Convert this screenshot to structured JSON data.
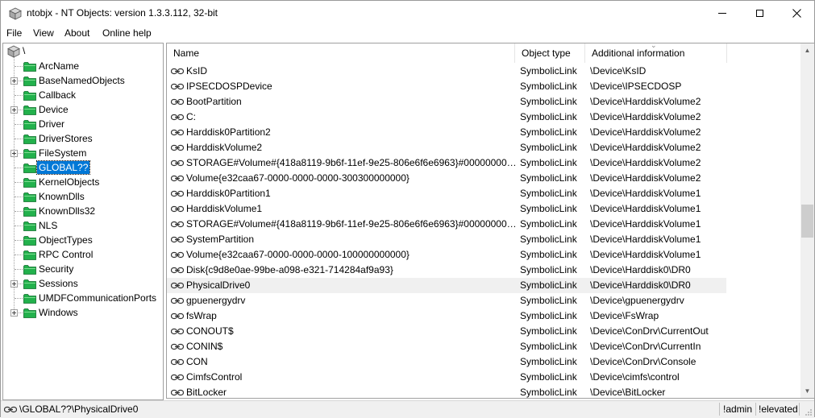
{
  "window": {
    "title": "ntobjx - NT Objects: version 1.3.3.112, 32-bit"
  },
  "menu": [
    "File",
    "View",
    "About",
    "Online help"
  ],
  "tree": {
    "root_label": "\\",
    "items": [
      {
        "label": "ArcName",
        "expandable": false,
        "selected": false
      },
      {
        "label": "BaseNamedObjects",
        "expandable": true,
        "selected": false
      },
      {
        "label": "Callback",
        "expandable": false,
        "selected": false
      },
      {
        "label": "Device",
        "expandable": true,
        "selected": false
      },
      {
        "label": "Driver",
        "expandable": false,
        "selected": false
      },
      {
        "label": "DriverStores",
        "expandable": false,
        "selected": false
      },
      {
        "label": "FileSystem",
        "expandable": true,
        "selected": false
      },
      {
        "label": "GLOBAL??",
        "expandable": false,
        "selected": true
      },
      {
        "label": "KernelObjects",
        "expandable": false,
        "selected": false
      },
      {
        "label": "KnownDlls",
        "expandable": false,
        "selected": false
      },
      {
        "label": "KnownDlls32",
        "expandable": false,
        "selected": false
      },
      {
        "label": "NLS",
        "expandable": false,
        "selected": false
      },
      {
        "label": "ObjectTypes",
        "expandable": false,
        "selected": false
      },
      {
        "label": "RPC Control",
        "expandable": false,
        "selected": false
      },
      {
        "label": "Security",
        "expandable": false,
        "selected": false
      },
      {
        "label": "Sessions",
        "expandable": true,
        "selected": false
      },
      {
        "label": "UMDFCommunicationPorts",
        "expandable": false,
        "selected": false
      },
      {
        "label": "Windows",
        "expandable": true,
        "selected": false
      }
    ]
  },
  "list": {
    "columns": [
      "Name",
      "Object type",
      "Additional information"
    ],
    "hovered_row": 14,
    "rows": [
      {
        "name": "KsID",
        "type": "SymbolicLink",
        "info": "\\Device\\KsID"
      },
      {
        "name": "IPSECDOSPDevice",
        "type": "SymbolicLink",
        "info": "\\Device\\IPSECDOSP"
      },
      {
        "name": "BootPartition",
        "type": "SymbolicLink",
        "info": "\\Device\\HarddiskVolume2"
      },
      {
        "name": "C:",
        "type": "SymbolicLink",
        "info": "\\Device\\HarddiskVolume2"
      },
      {
        "name": "Harddisk0Partition2",
        "type": "SymbolicLink",
        "info": "\\Device\\HarddiskVolume2"
      },
      {
        "name": "HarddiskVolume2",
        "type": "SymbolicLink",
        "info": "\\Device\\HarddiskVolume2"
      },
      {
        "name": "STORAGE#Volume#{418a8119-9b6f-11ef-9e25-806e6f6e6963}#000000000330...",
        "type": "SymbolicLink",
        "info": "\\Device\\HarddiskVolume2"
      },
      {
        "name": "Volume{e32caa67-0000-0000-0000-300300000000}",
        "type": "SymbolicLink",
        "info": "\\Device\\HarddiskVolume2"
      },
      {
        "name": "Harddisk0Partition1",
        "type": "SymbolicLink",
        "info": "\\Device\\HarddiskVolume1"
      },
      {
        "name": "HarddiskVolume1",
        "type": "SymbolicLink",
        "info": "\\Device\\HarddiskVolume1"
      },
      {
        "name": "STORAGE#Volume#{418a8119-9b6f-11ef-9e25-806e6f6e6963}#000000000010...",
        "type": "SymbolicLink",
        "info": "\\Device\\HarddiskVolume1"
      },
      {
        "name": "SystemPartition",
        "type": "SymbolicLink",
        "info": "\\Device\\HarddiskVolume1"
      },
      {
        "name": "Volume{e32caa67-0000-0000-0000-100000000000}",
        "type": "SymbolicLink",
        "info": "\\Device\\HarddiskVolume1"
      },
      {
        "name": "Disk{c9d8e0ae-99be-a098-e321-714284af9a93}",
        "type": "SymbolicLink",
        "info": "\\Device\\Harddisk0\\DR0"
      },
      {
        "name": "PhysicalDrive0",
        "type": "SymbolicLink",
        "info": "\\Device\\Harddisk0\\DR0"
      },
      {
        "name": "gpuenergydrv",
        "type": "SymbolicLink",
        "info": "\\Device\\gpuenergydrv"
      },
      {
        "name": "fsWrap",
        "type": "SymbolicLink",
        "info": "\\Device\\FsWrap"
      },
      {
        "name": "CONOUT$",
        "type": "SymbolicLink",
        "info": "\\Device\\ConDrv\\CurrentOut"
      },
      {
        "name": "CONIN$",
        "type": "SymbolicLink",
        "info": "\\Device\\ConDrv\\CurrentIn"
      },
      {
        "name": "CON",
        "type": "SymbolicLink",
        "info": "\\Device\\ConDrv\\Console"
      },
      {
        "name": "CimfsControl",
        "type": "SymbolicLink",
        "info": "\\Device\\cimfs\\control"
      },
      {
        "name": "BitLocker",
        "type": "SymbolicLink",
        "info": "\\Device\\BitLocker"
      }
    ]
  },
  "status": {
    "path": "\\GLOBAL??\\PhysicalDrive0",
    "admin": "!admin",
    "elevated": "!elevated"
  },
  "colors": {
    "selection": "#0078d7",
    "folder": "#22b14c",
    "hover_row": "#f0f0f0"
  }
}
